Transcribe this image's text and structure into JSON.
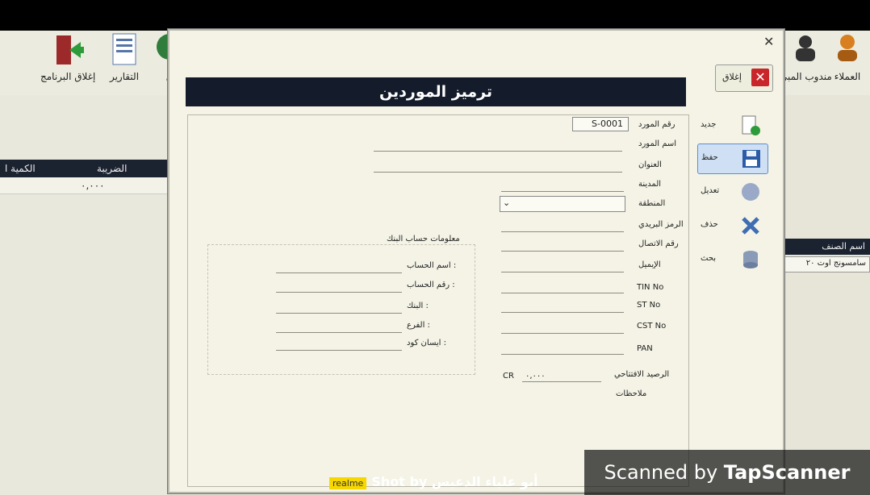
{
  "toolbar": {
    "exit_label": "إغلاق البرنامج",
    "reports_label": "التقارير",
    "partial_label": "ل",
    "customers_label": "العملاء",
    "rep_label": "مندوب المبي"
  },
  "background_grid": {
    "columns": [
      "الضريبة",
      "الكمية ا"
    ],
    "row_value": "٠,٠٠٠"
  },
  "right_panel": {
    "column": "اسم الصنف",
    "cell": "سامسونج اوت ٢٠"
  },
  "dialog": {
    "close_glyph": "✕",
    "title": "ترميز الموردين",
    "exit_button": "إغلاق",
    "side_buttons": [
      "جديد",
      "حفظ",
      "تعديل",
      "حذف",
      "بحث"
    ],
    "fields": {
      "supplier_no_label": "رقم المورد",
      "supplier_no_value": "S-0001",
      "supplier_name_label": "اسم المورد",
      "address_label": "العنوان",
      "city_label": "المدينة",
      "region_label": "المنطقة",
      "postal_label": "الرمز البريدي",
      "phone_label": "رقم الاتصال",
      "email_label": "الإيميل",
      "tin_label": "TIN No",
      "st_label": "ST No",
      "cst_label": "CST No",
      "pan_label": "PAN",
      "opening_balance_label": "الرصيد الافتتاحي",
      "opening_balance_value": "٠,٠٠٠",
      "cr_label": "CR",
      "notes_label": "ملاحظات"
    },
    "bank": {
      "title": "معلومات حساب البنك",
      "account_name_label": "اسم الحساب :",
      "account_no_label": "رقم الحساب :",
      "bank_label": "البنك :",
      "branch_label": "الفرع :",
      "ifsc_label": "ايسان كود :"
    }
  },
  "overlay": {
    "scanned_prefix": "Scanned by ",
    "scanned_brand": "TapScanner",
    "watermark_brand": "realme",
    "watermark_text": "Shot by أبو علياء الدعيس"
  }
}
